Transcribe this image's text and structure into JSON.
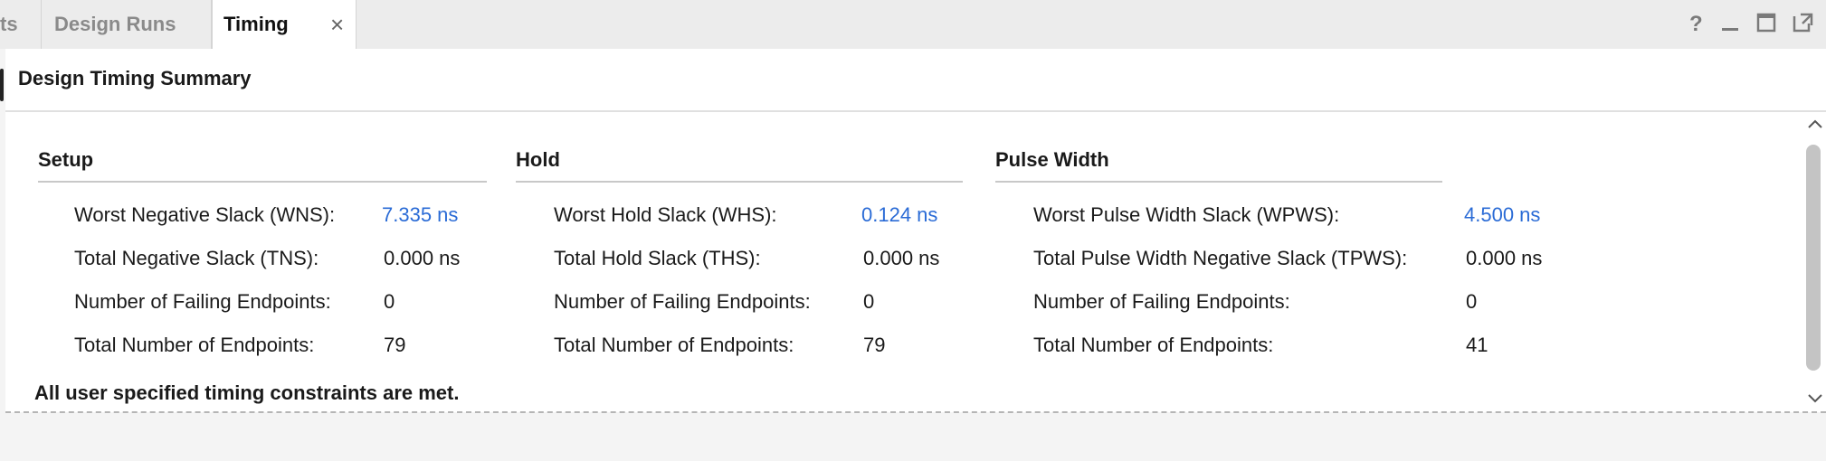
{
  "tabs": [
    {
      "label": "ts",
      "state": "inactive"
    },
    {
      "label": "Design Runs",
      "state": "inactive"
    },
    {
      "label": "Timing",
      "state": "active"
    }
  ],
  "tab_close_glyph": "×",
  "window_controls": [
    "help-icon",
    "minimize-icon",
    "maximize-icon",
    "float-icon"
  ],
  "window_controls_glyphs": {
    "help": "?"
  },
  "panel": {
    "title": "Design Timing Summary"
  },
  "sections": {
    "setup": {
      "title": "Setup",
      "rows": [
        {
          "label": "Worst Negative Slack (WNS):",
          "value": "7.335 ns",
          "link": true
        },
        {
          "label": "Total Negative Slack (TNS):",
          "value": "0.000 ns",
          "link": false
        },
        {
          "label": "Number of Failing Endpoints:",
          "value": "0",
          "link": false
        },
        {
          "label": "Total Number of Endpoints:",
          "value": "79",
          "link": false
        }
      ]
    },
    "hold": {
      "title": "Hold",
      "rows": [
        {
          "label": "Worst Hold Slack (WHS):",
          "value": "0.124 ns",
          "link": true
        },
        {
          "label": "Total Hold Slack (THS):",
          "value": "0.000 ns",
          "link": false
        },
        {
          "label": "Number of Failing Endpoints:",
          "value": "0",
          "link": false
        },
        {
          "label": "Total Number of Endpoints:",
          "value": "79",
          "link": false
        }
      ]
    },
    "pulse": {
      "title": "Pulse Width",
      "rows": [
        {
          "label": "Worst Pulse Width Slack (WPWS):",
          "value": "4.500 ns",
          "link": true
        },
        {
          "label": "Total Pulse Width Negative Slack (TPWS):",
          "value": "0.000 ns",
          "link": false
        },
        {
          "label": "Number of Failing Endpoints:",
          "value": "0",
          "link": false
        },
        {
          "label": "Total Number of Endpoints:",
          "value": "41",
          "link": false
        }
      ]
    }
  },
  "footer_message": "All user specified timing constraints are met.",
  "colors": {
    "link": "#2a6bd6",
    "tabbar": "#ececec",
    "panel": "#ffffff"
  }
}
